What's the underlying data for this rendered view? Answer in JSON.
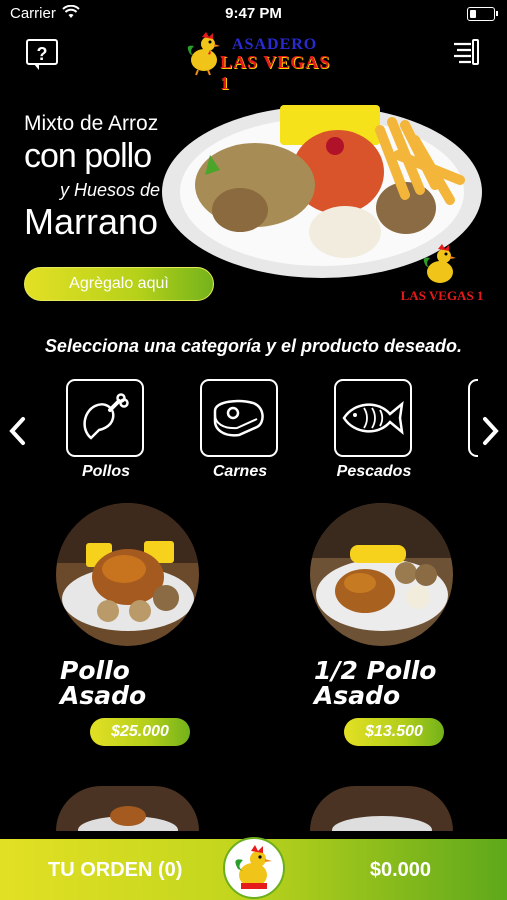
{
  "status_bar": {
    "carrier": "Carrier",
    "time": "9:47 PM"
  },
  "header": {
    "help_label": "?",
    "logo_line1": "ASADERO",
    "logo_line2": "LAS VEGAS 1"
  },
  "promo": {
    "line1": "Mixto de Arroz",
    "line2": "con pollo",
    "line3": "y Huesos de",
    "line4": "Marrano",
    "button_label": "Agrègalo aquì",
    "brand": "LAS VEGAS 1"
  },
  "section_title": "Selecciona una categoría y el producto deseado.",
  "categories": [
    {
      "label": "Pollos",
      "icon": "chicken-leg-icon"
    },
    {
      "label": "Carnes",
      "icon": "steak-icon"
    },
    {
      "label": "Pescados",
      "icon": "fish-icon"
    }
  ],
  "products": [
    {
      "name_line1": "Pollo",
      "name_line2": "Asado",
      "price": "$25.000"
    },
    {
      "name_line1": "1/2 Pollo",
      "name_line2": "Asado",
      "price": "$13.500"
    }
  ],
  "order_bar": {
    "label": "TU ORDEN (0)",
    "total": "$0.000"
  },
  "colors": {
    "accent_start": "#e3e024",
    "accent_end": "#5ea81b",
    "brand_red": "#e51b1b",
    "brand_blue": "#2a2ad0"
  }
}
